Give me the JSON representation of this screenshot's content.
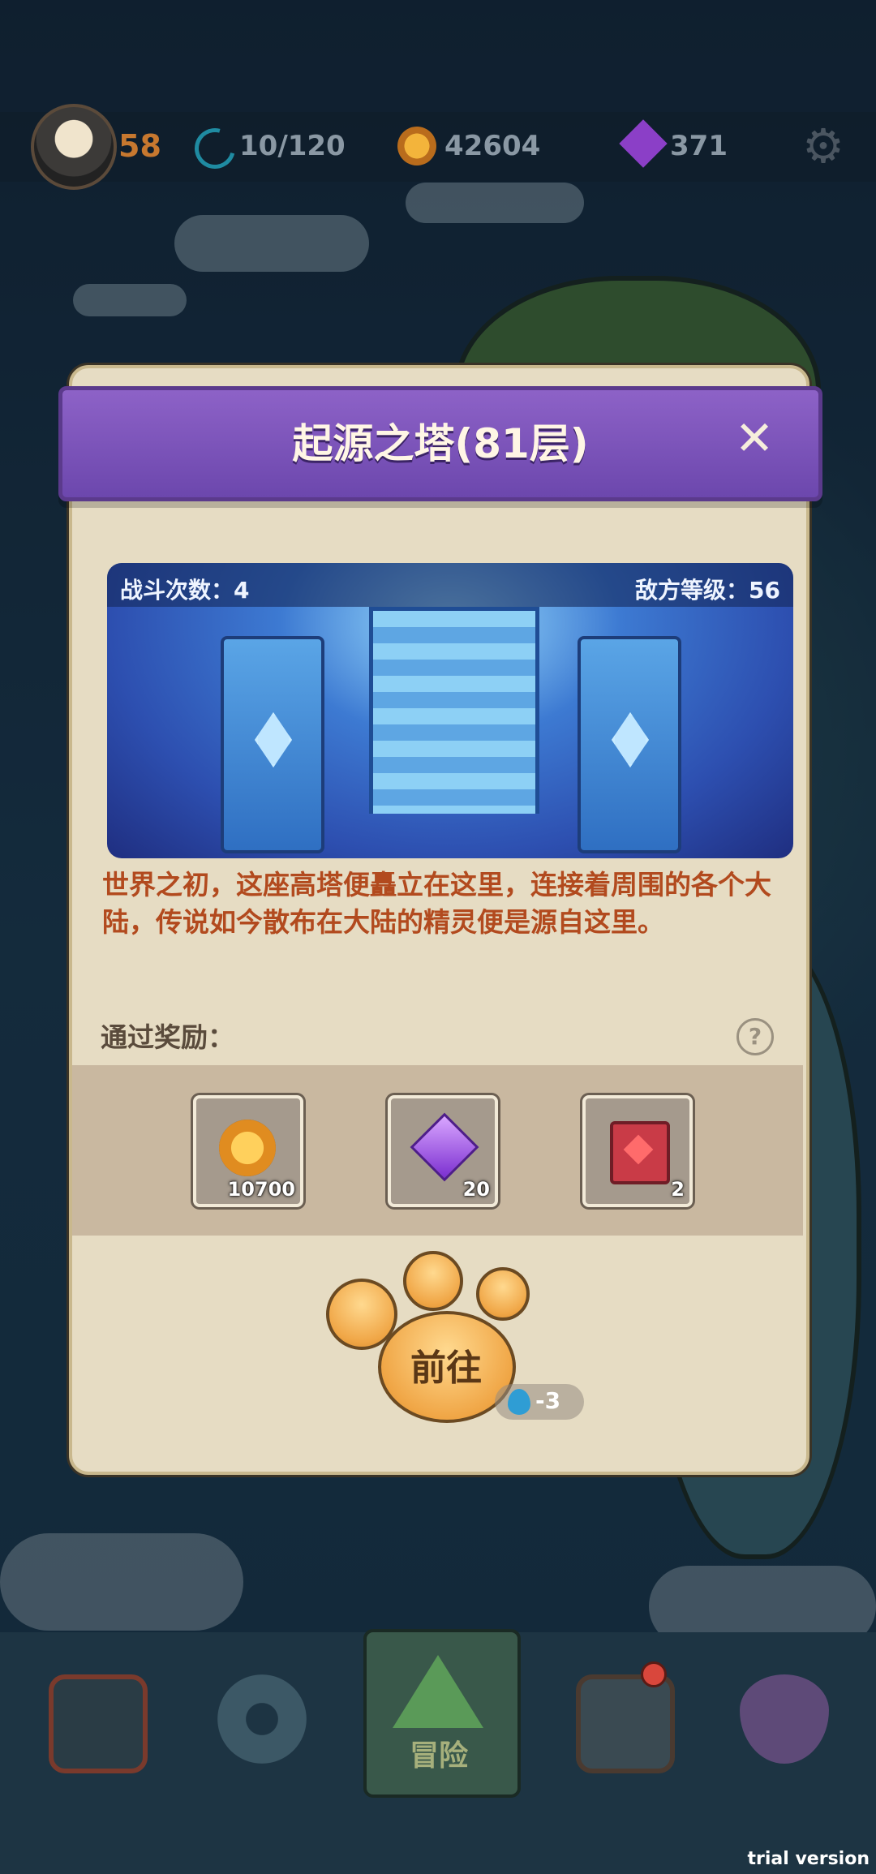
{
  "topbar": {
    "player_level": "58",
    "energy": "10/120",
    "coins": "42604",
    "gems": "371"
  },
  "dialog": {
    "title": "起源之塔(81层)",
    "close_icon": "close-icon",
    "battle_count_label": "战斗次数：4",
    "enemy_level_label": "敌方等级：56",
    "description": "世界之初，这座高塔便矗立在这里，连接着周围的各个大陆，传说如今散布在大陆的精灵便是源自这里。",
    "reward_label": "通过奖励：",
    "help_symbol": "?",
    "rewards": [
      {
        "icon": "coin-icon",
        "count": "10700"
      },
      {
        "icon": "gem-icon",
        "count": "20"
      },
      {
        "icon": "book-icon",
        "count": "2"
      }
    ],
    "go_button": "前往",
    "cost": "-3"
  },
  "bottom_nav": {
    "active_label": "冒险"
  },
  "watermark": "trial version"
}
